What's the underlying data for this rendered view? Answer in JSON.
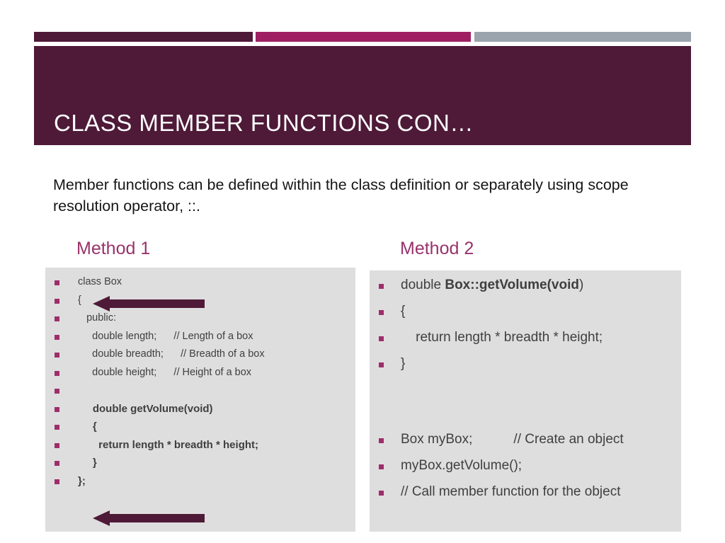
{
  "slide": {
    "title": "CLASS MEMBER FUNCTIONS CON…",
    "intro": "Member functions can be defined within the class definition or separately using scope resolution operator, ::.",
    "colors": {
      "dark_maroon": "#4E1A38",
      "magenta": "#9E2062",
      "gray": "#9BA4AC",
      "heading_plum": "#99336B",
      "panel_bg": "#DEDEDE",
      "bullet": "#9E2D6B",
      "code_text": "#3F3F3F"
    }
  },
  "topbars": [
    {
      "name": "bar-dark",
      "color": "#4E1A38"
    },
    {
      "name": "bar-magenta",
      "color": "#9E2062"
    },
    {
      "name": "bar-gray",
      "color": "#9BA4AC"
    }
  ],
  "methods": [
    {
      "heading": "Method 1"
    },
    {
      "heading": "Method 2"
    }
  ],
  "left_panel": {
    "lines": [
      {
        "text": "class Box",
        "bold": false
      },
      {
        "text": "{",
        "bold": false
      },
      {
        "text": "   public:",
        "bold": false
      },
      {
        "text": "     double length;      // Length of a box",
        "bold": false
      },
      {
        "text": "     double breadth;      // Breadth of a box",
        "bold": false
      },
      {
        "text": "     double height;      // Height of a box",
        "bold": false
      },
      {
        "text": "",
        "bold": false
      },
      {
        "text": "     double getVolume(void)",
        "bold": true
      },
      {
        "text": "     {",
        "bold": true
      },
      {
        "text": "       return length * breadth * height;",
        "bold": true
      },
      {
        "text": "     }",
        "bold": true
      },
      {
        "text": "};",
        "bold": true
      }
    ]
  },
  "right_panel": {
    "lines": [
      {
        "pre": "double ",
        "strong": "Box::getVolume(void",
        "post": ")"
      },
      {
        "pre": "{",
        "strong": "",
        "post": ""
      },
      {
        "pre": "    return length * breadth * height;",
        "strong": "",
        "post": ""
      },
      {
        "pre": "}",
        "strong": "",
        "post": ""
      },
      {
        "pre": "Box myBox;           // Create an object",
        "strong": "",
        "post": ""
      },
      {
        "pre": "myBox.getVolume();",
        "strong": "",
        "post": ""
      },
      {
        "pre": "// Call member function for the object",
        "strong": "",
        "post": ""
      }
    ]
  },
  "arrows": [
    {
      "name": "arrow-open-brace",
      "direction": "left"
    },
    {
      "name": "arrow-close-brace",
      "direction": "left"
    }
  ]
}
